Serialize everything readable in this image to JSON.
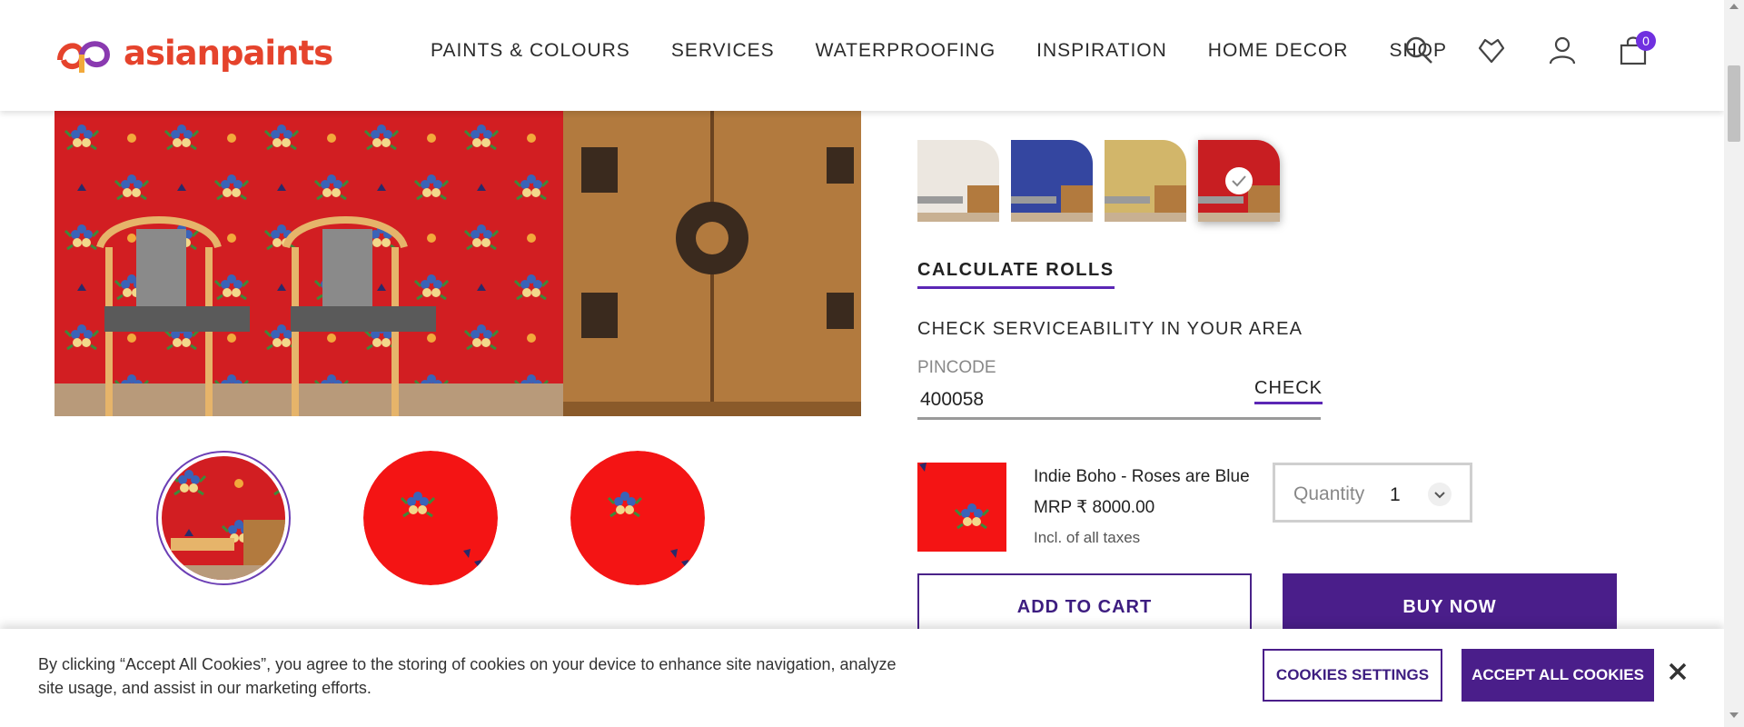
{
  "brand": {
    "name": "asianpaints",
    "accent": "#4a1e8a",
    "brand_color": "#e5432c"
  },
  "nav": {
    "items": [
      "PAINTS & COLOURS",
      "SERVICES",
      "WATERPROOFING",
      "INSPIRATION",
      "HOME DECOR",
      "SHOP"
    ]
  },
  "header_icons": {
    "search": "search-icon",
    "wishlist": "heart-icon",
    "account": "user-icon",
    "cart": "shopping-bag-icon",
    "cart_count": "0"
  },
  "product": {
    "swatches": [
      "white",
      "blue",
      "gold",
      "red"
    ],
    "selected_swatch": "red",
    "calculate_rolls": "CALCULATE ROLLS",
    "serviceability_title": "CHECK SERVICEABILITY IN YOUR AREA",
    "pincode_label": "PINCODE",
    "pincode_value": "400058",
    "check_label": "CHECK",
    "name": "Indie Boho - Roses are Blue",
    "mrp": "MRP ₹ 8000.00",
    "tax_note": "Incl. of all taxes",
    "quantity_label": "Quantity",
    "quantity_value": "1",
    "add_to_cart": "ADD TO CART",
    "buy_now": "BUY NOW"
  },
  "cookie": {
    "text": "By clicking “Accept All Cookies”, you agree to the storing of cookies on your device to enhance site navigation, analyze site usage, and assist in our marketing efforts.",
    "settings_label": "COOKIES SETTINGS",
    "accept_label": "ACCEPT ALL COOKIES"
  }
}
